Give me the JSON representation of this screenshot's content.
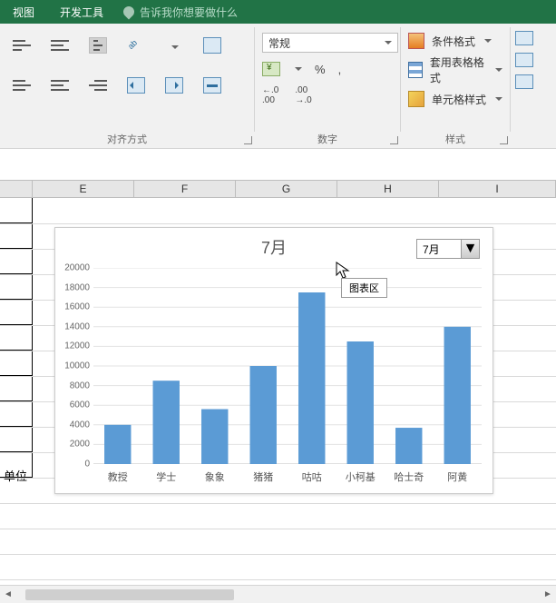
{
  "tabs": {
    "view": "视图",
    "dev": "开发工具"
  },
  "tellme": "告诉我你想要做什么",
  "ribbon": {
    "align_group": "对齐方式",
    "number_group": "数字",
    "styles_group": "样式",
    "number_format": "常规",
    "percent": "%",
    "comma": ",",
    "inc_dec": ".00",
    "dec_inc": ".00",
    "inc_arrow": "←.0",
    "dec_arrow": "→.0",
    "cond_format": "条件格式",
    "table_format": "套用表格格式",
    "cell_style": "单元格样式"
  },
  "columns": [
    "E",
    "F",
    "G",
    "H",
    "I"
  ],
  "unit_label": "单位",
  "cursor_tooltip": "图表区",
  "month_selector": "7月",
  "chart_data": {
    "type": "bar",
    "title": "7月",
    "xlabel": "",
    "ylabel": "",
    "ylim": [
      0,
      20000
    ],
    "ytick_step": 2000,
    "categories": [
      "教授",
      "学士",
      "象象",
      "猪猪",
      "咕咕",
      "小柯基",
      "哈士奇",
      "阿黄"
    ],
    "values": [
      4000,
      8500,
      5600,
      10000,
      17500,
      12500,
      3700,
      14000
    ]
  }
}
